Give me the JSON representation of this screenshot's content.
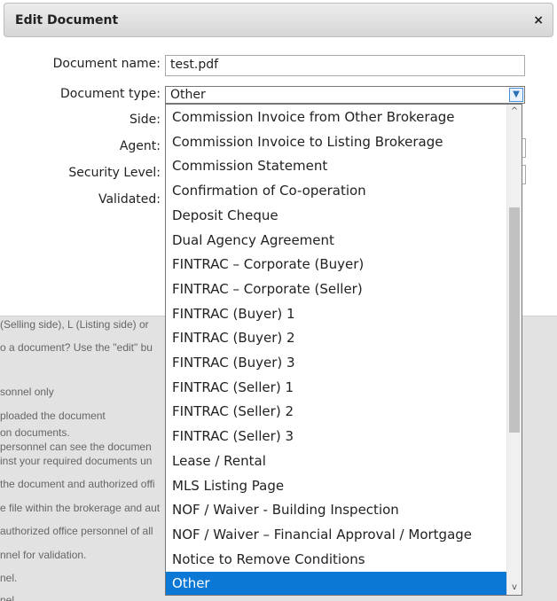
{
  "modal": {
    "title": "Edit Document",
    "close_glyph": "×"
  },
  "form": {
    "name_label": "Document name:",
    "name_value": "test.pdf",
    "type_label": "Document type:",
    "type_value": "Other",
    "side_label": "Side:",
    "agent_label": "Agent:",
    "security_label": "Security Level:",
    "validated_label": "Validated:"
  },
  "dropdown": {
    "options": [
      "Commission Invoice from Other Brokerage",
      "Commission Invoice to Listing Brokerage",
      "Commission Statement",
      "Confirmation of Co-operation",
      "Deposit Cheque",
      "Dual Agency Agreement",
      "FINTRAC – Corporate (Buyer)",
      "FINTRAC – Corporate (Seller)",
      "FINTRAC (Buyer) 1",
      "FINTRAC (Buyer) 2",
      "FINTRAC (Buyer) 3",
      "FINTRAC (Seller) 1",
      "FINTRAC (Seller) 2",
      "FINTRAC (Seller) 3",
      "Lease / Rental",
      "MLS Listing Page",
      "NOF / Waiver - Building Inspection",
      "NOF / Waiver – Financial Approval / Mortgage",
      "Notice to Remove Conditions",
      "Other"
    ],
    "selected_index": 19,
    "scroll_up": "^",
    "scroll_down": "v"
  },
  "background_page": {
    "lines": [
      "(Selling side), L (Listing side) or",
      "o a document? Use the \"edit\" bu",
      "sonnel only",
      "ploaded the document",
      "on documents.",
      "personnel can see the documen",
      "inst your required documents un",
      "the document and authorized offi",
      "e file within the brokerage and aut",
      "authorized office personnel of all",
      "nnel for validation.",
      "nel.",
      "nel"
    ]
  },
  "colors": {
    "selected_bg": "#0a78d4",
    "overlay_bg": "#e2e2e2"
  }
}
